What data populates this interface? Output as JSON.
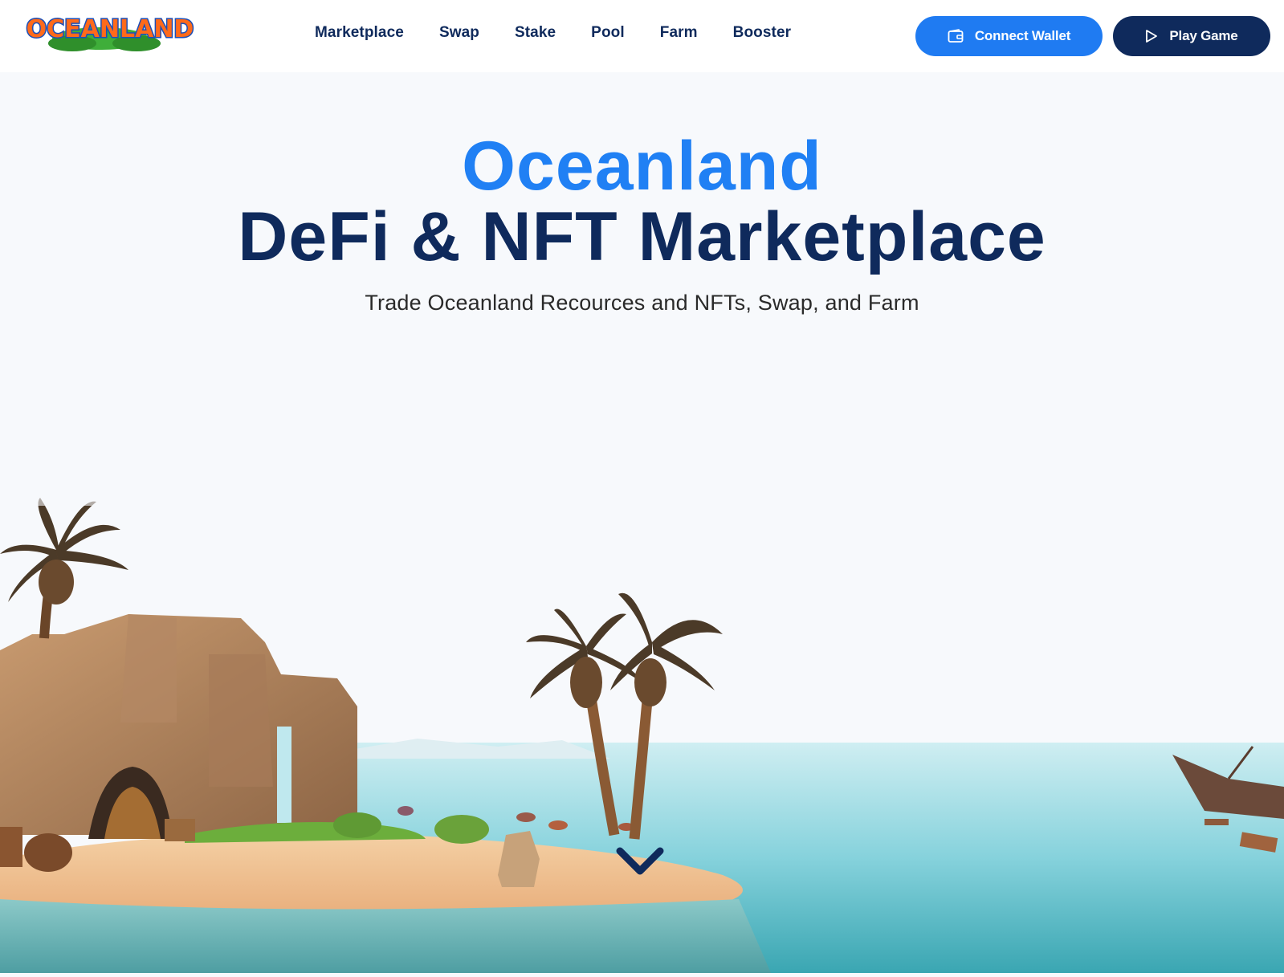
{
  "brand": {
    "logo_text": "OCEANLAND"
  },
  "nav": {
    "items": [
      {
        "label": "Marketplace"
      },
      {
        "label": "Swap"
      },
      {
        "label": "Stake"
      },
      {
        "label": "Pool"
      },
      {
        "label": "Farm"
      },
      {
        "label": "Booster"
      }
    ]
  },
  "actions": {
    "connect_wallet": {
      "label": "Connect Wallet",
      "icon": "wallet-icon"
    },
    "play_game": {
      "label": "Play Game",
      "icon": "play-icon"
    }
  },
  "hero": {
    "title_line1": "Oceanland",
    "title_line2": "DeFi & NFT Marketplace",
    "subtitle": "Trade Oceanland Recources and NFTs, Swap, and Farm",
    "scroll_icon": "chevron-down-icon"
  },
  "colors": {
    "accent": "#1f7bf2",
    "navy": "#0f2a5c",
    "background": "#f7f9fc",
    "sea": "#7fd0dc",
    "sand": "#f2c89a"
  }
}
